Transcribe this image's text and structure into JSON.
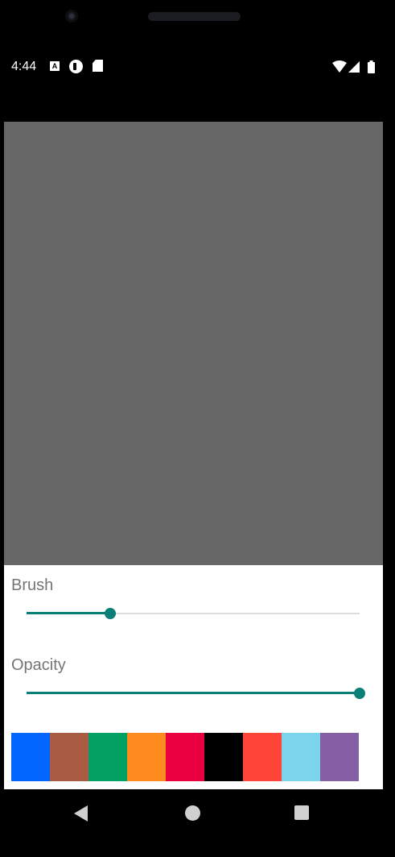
{
  "status_bar": {
    "time": "4:44",
    "notification_icons": [
      "a-badge-icon",
      "circle-p-icon",
      "sd-card-icon"
    ],
    "right_icons": [
      "wifi-icon",
      "signal-icon",
      "battery-icon"
    ]
  },
  "canvas": {
    "background_color": "#676767"
  },
  "controls": {
    "brush_label": "Brush",
    "brush_level": 0.25,
    "opacity_label": "Opacity",
    "opacity_level": 1.0,
    "accent_color": "#0a7f77"
  },
  "palette": {
    "colors": [
      "#0066ff",
      "#a95c42",
      "#02a063",
      "#ff8a1e",
      "#ea0040",
      "#000000",
      "#ff4438",
      "#7ad5ec",
      "#855fa6"
    ]
  },
  "nav_bar": {
    "buttons": [
      "back-icon",
      "home-icon",
      "recents-icon"
    ]
  }
}
